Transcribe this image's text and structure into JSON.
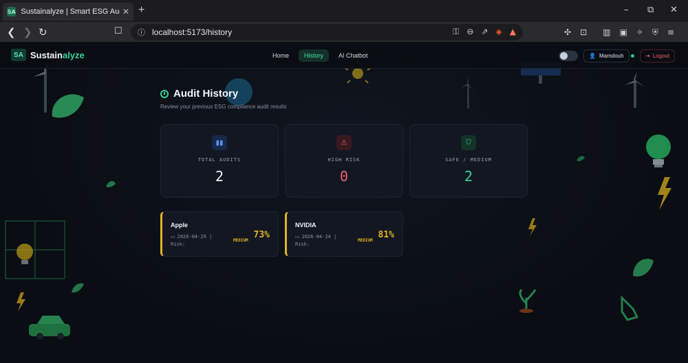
{
  "browser": {
    "tab_title": "Sustainalyze | Smart ESG Auditor",
    "tab_favicon": "SA",
    "url": "localhost:5173/history",
    "win_controls": [
      "–",
      "⧉",
      "✕"
    ]
  },
  "app": {
    "logo_mark": "SA",
    "brand_part1": "Sustain",
    "brand_part2": "alyze",
    "nav": [
      {
        "label": "Home",
        "active": false
      },
      {
        "label": "History",
        "active": true
      },
      {
        "label": "AI Chatbot",
        "active": false
      }
    ],
    "user_name": "Mamdouh",
    "logout_label": "Logout"
  },
  "page": {
    "title": "Audit History",
    "subtitle": "Review your previous ESG compliance audit results"
  },
  "stats": [
    {
      "label": "TOTAL AUDITS",
      "value": "2",
      "icon": "bar-chart-icon",
      "color": "#5b8def"
    },
    {
      "label": "HIGH RISK",
      "value": "0",
      "icon": "warning-icon",
      "color": "#f0626c"
    },
    {
      "label": "SAFE / MEDIUM",
      "value": "2",
      "icon": "shield-check-icon",
      "color": "#37d39a"
    }
  ],
  "audits": [
    {
      "company": "Apple",
      "date": "2026-04-29",
      "risk_label": "Risk:",
      "risk_level": "MEDIUM",
      "score": "73%"
    },
    {
      "company": "NVIDIA",
      "date": "2026-04-24",
      "risk_label": "Risk:",
      "risk_level": "MEDIUM",
      "score": "81%"
    }
  ],
  "colors": {
    "accent": "#37d39a",
    "warning": "#e3b324",
    "danger": "#f0626c",
    "background": "#0a0d13",
    "card": "#121722"
  }
}
